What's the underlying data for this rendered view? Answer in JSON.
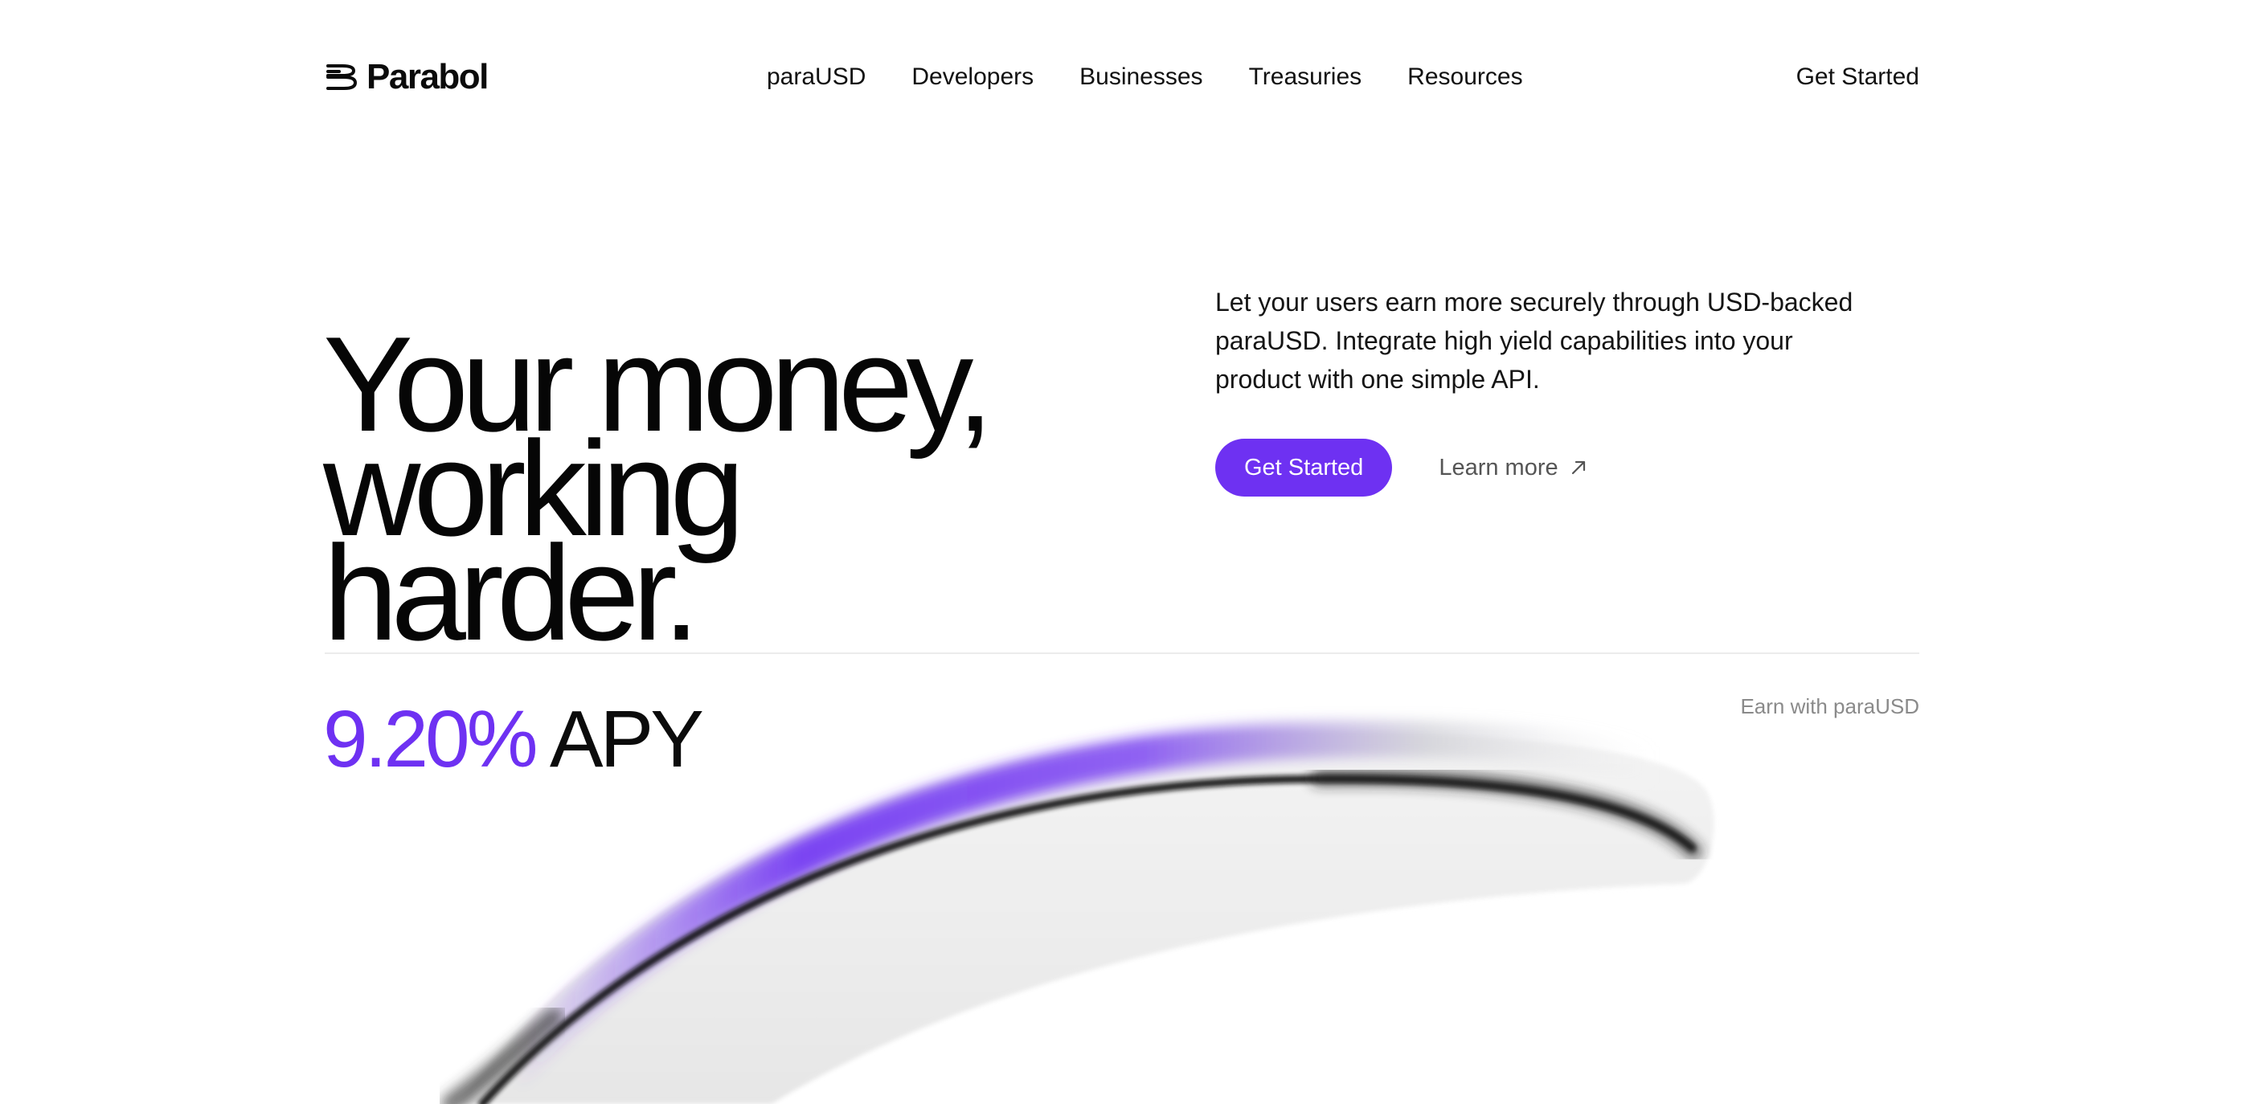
{
  "header": {
    "brand": "Parabol",
    "nav": [
      "paraUSD",
      "Developers",
      "Businesses",
      "Treasuries",
      "Resources"
    ],
    "cta": "Get Started"
  },
  "hero": {
    "headline": [
      "Your money,",
      "working",
      "harder."
    ],
    "description": "Let your users earn more securely through USD-backed paraUSD. Integrate high yield capabilities into your product with one simple API.",
    "primary_cta": "Get Started",
    "secondary_cta": "Learn more"
  },
  "stats": {
    "apy_value": "9.20%",
    "apy_label": "APY",
    "earn_label": "Earn with paraUSD"
  },
  "colors": {
    "accent": "#6e31f2",
    "text": "#0b0b0b",
    "muted": "#8a8a8a",
    "divider": "#ececec"
  },
  "icons": [
    "parabol-logo-icon",
    "arrow-up-right-icon"
  ]
}
